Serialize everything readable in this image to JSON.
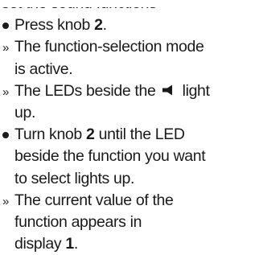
{
  "markers": {
    "bullet": "•",
    "result": "»"
  },
  "icons": {
    "speaker": "speaker-icon"
  },
  "lines": {
    "l0": "set the sound functions",
    "l1a": "Press knob ",
    "l1b": "2",
    "l1c": ".",
    "l2": "The function-selection mode",
    "l3": "is active.",
    "l4a": "The LEDs beside the ",
    "l4b": " light",
    "l5": "up.",
    "l6a": "Turn knob ",
    "l6b": "2",
    "l6c": " until the LED",
    "l7": "beside the function you want",
    "l8": "to select lights up.",
    "l9": "The current value of the",
    "l10": "function appears in",
    "l11a": "display ",
    "l11b": "1",
    "l11c": "."
  }
}
